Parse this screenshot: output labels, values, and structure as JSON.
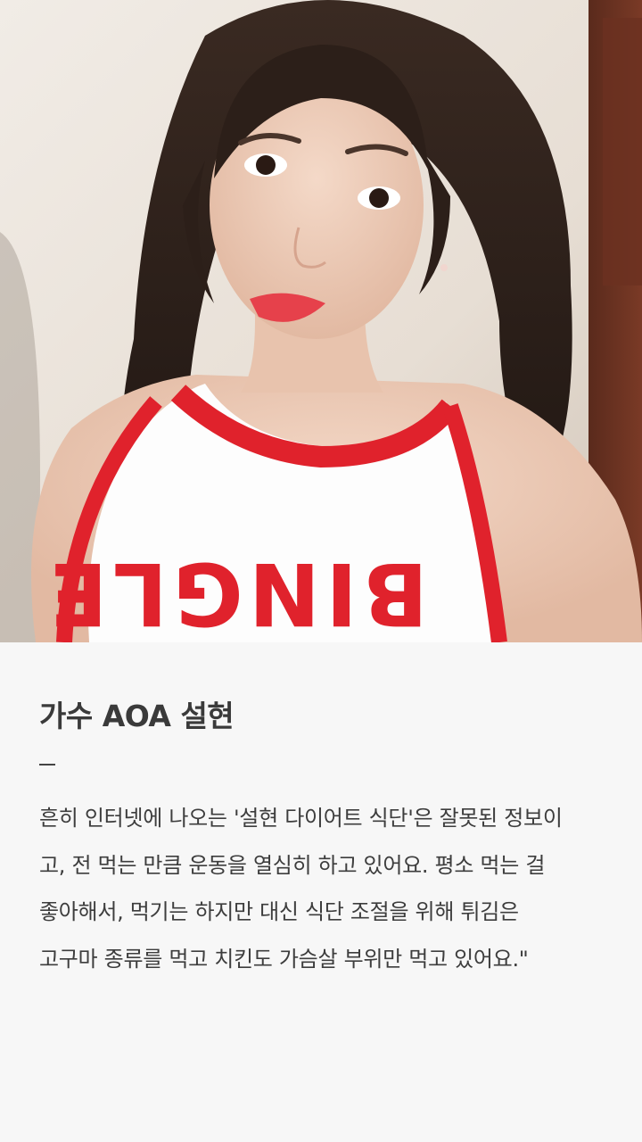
{
  "photo": {
    "alt": "AOA 설현 셀카",
    "shirt_text": "BINGLE"
  },
  "article": {
    "title": "가수 AOA 설현",
    "divider": "–",
    "lines": [
      "흔히 인터넷에 나오는 '설현 다이어트 식단'은 잘못된 정보이",
      "고, 전 먹는 만큼 운동을 열심히 하고 있어요. 평소 먹는 걸",
      "좋아해서, 먹기는 하지만 대신 식단 조절을 위해 튀김은",
      "고구마 종류를 먹고 치킨도 가슴살 부위만 먹고 있어요.\""
    ]
  },
  "colors": {
    "background": "#f7f7f7",
    "title": "#3a3a3a",
    "body": "#3d3d3d",
    "shirt_trim": "#e0222c"
  }
}
